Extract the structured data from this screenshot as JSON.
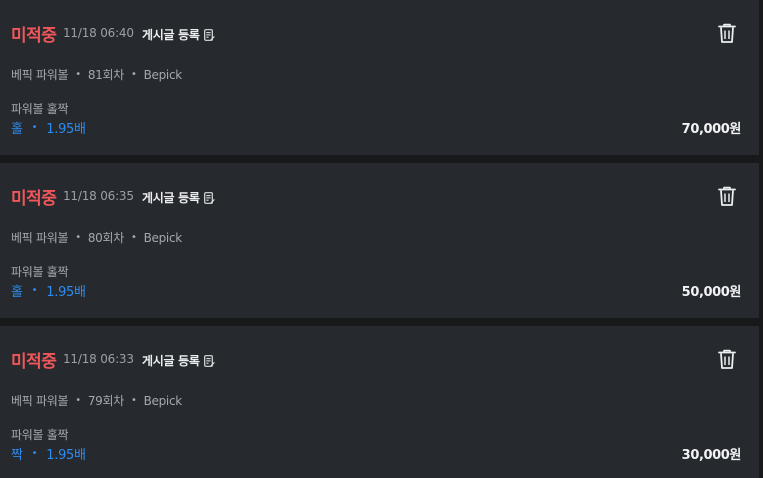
{
  "bets": [
    {
      "status": "미적중",
      "time": "11/18 06:40",
      "post_label": "게시글 등록",
      "game": "베픽 파워볼",
      "round": "81회차",
      "site": "Bepick",
      "bet_type": "파워볼 홀짝",
      "pick": "홀",
      "odds": "1.95배",
      "amount": "70,000원"
    },
    {
      "status": "미적중",
      "time": "11/18 06:35",
      "post_label": "게시글 등록",
      "game": "베픽 파워볼",
      "round": "80회차",
      "site": "Bepick",
      "bet_type": "파워볼 홀짝",
      "pick": "홀",
      "odds": "1.95배",
      "amount": "50,000원"
    },
    {
      "status": "미적중",
      "time": "11/18 06:33",
      "post_label": "게시글 등록",
      "game": "베픽 파워볼",
      "round": "79회차",
      "site": "Bepick",
      "bet_type": "파워볼 홀짝",
      "pick": "짝",
      "odds": "1.95배",
      "amount": "30,000원"
    }
  ],
  "separator": "•",
  "colors": {
    "status_miss": "#f0565a",
    "pick": "#2d8cf0",
    "card_bg": "#262a2e",
    "page_bg": "#17191b"
  },
  "icons": {
    "post": "edit-document-icon",
    "delete": "trash-icon"
  }
}
